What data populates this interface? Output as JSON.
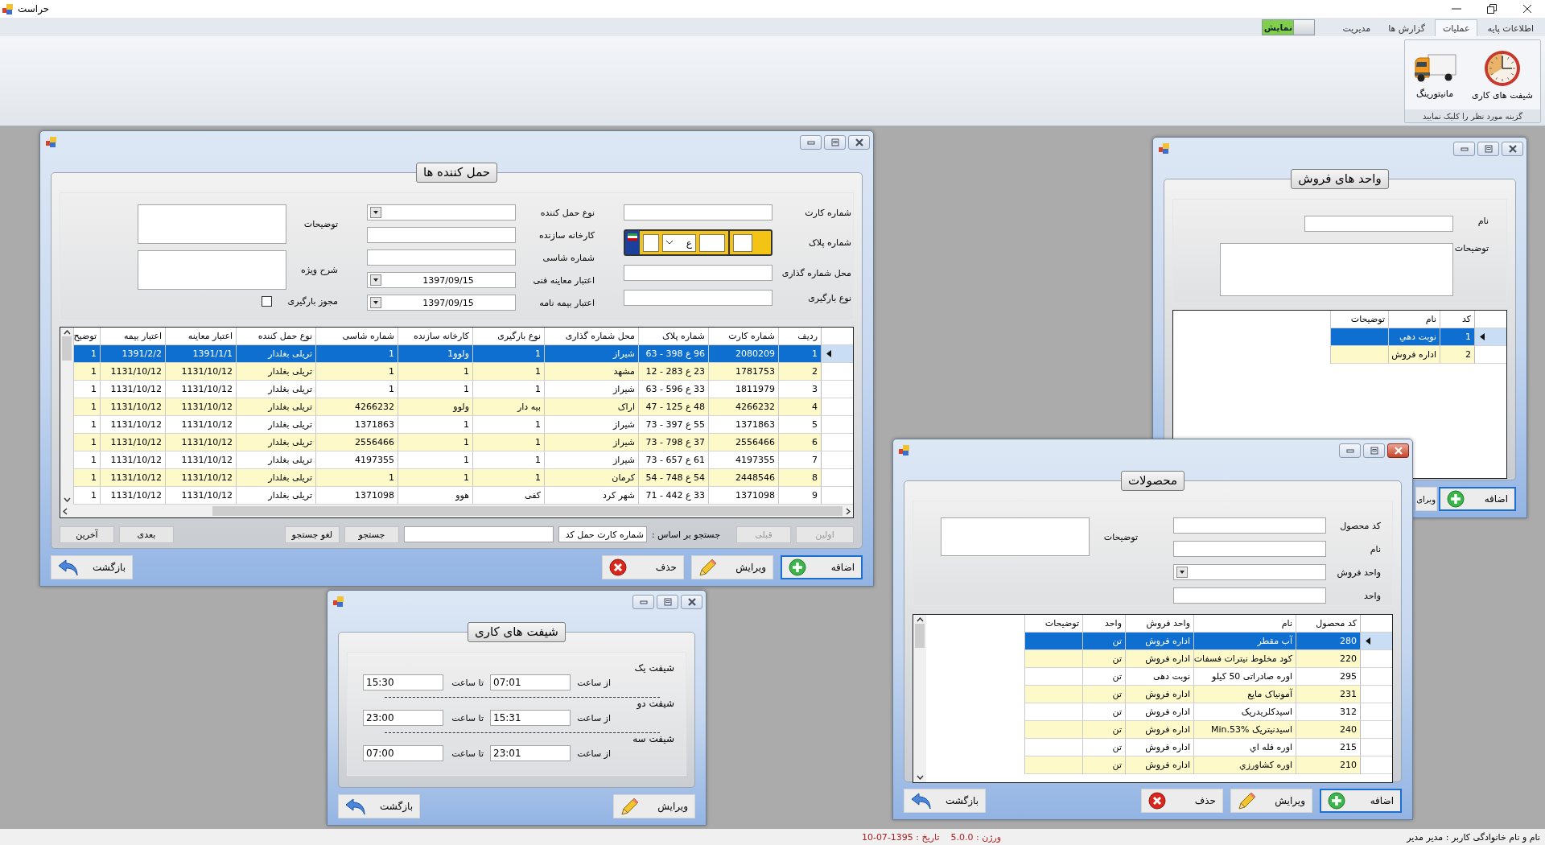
{
  "app": {
    "title": "حراست"
  },
  "ribbon": {
    "tabs": [
      {
        "label": "اطلاعات پایه",
        "selected": false
      },
      {
        "label": "عملیات",
        "selected": true
      },
      {
        "label": "گزارش ها",
        "selected": false
      },
      {
        "label": "مدیریت",
        "selected": false
      }
    ],
    "toggle": {
      "label": "نمایش",
      "on": true
    },
    "group": {
      "caption": "گزینه مورد نظر را کلیک نمایید",
      "buttons": [
        {
          "label": "شیفت های کاری",
          "kind": "clock"
        },
        {
          "label": "مانیتورینگ",
          "kind": "truck"
        }
      ]
    }
  },
  "carriers_window": {
    "active": false,
    "heading": "حمل کننده ها",
    "form_columns": [
      [
        {
          "kind": "text",
          "label": "شماره کارت"
        },
        {
          "kind": "plate",
          "label": "شماره پلاک",
          "letter": "ع"
        },
        {
          "kind": "text",
          "label": "محل شماره گذاری"
        },
        {
          "kind": "text",
          "label": "نوع بارگیری"
        }
      ],
      [
        {
          "kind": "combo",
          "label": "نوع حمل کننده"
        },
        {
          "kind": "text",
          "label": "کارخانه سازنده"
        },
        {
          "kind": "text",
          "label": "شماره شاسی"
        },
        {
          "kind": "date",
          "label": "اعتبار معاینه فنی",
          "value": "1397/09/15"
        },
        {
          "kind": "date",
          "label": "اعتبار بیمه نامه",
          "value": "1397/09/15"
        }
      ],
      [
        {
          "kind": "memo",
          "label": "توضیحات"
        },
        {
          "kind": "memo",
          "label": "شرح ویژه"
        },
        {
          "kind": "checkbox",
          "label": "مجوز بارگیری",
          "checked": false
        }
      ]
    ],
    "table": {
      "columns": [
        "ردیف",
        "شماره کارت",
        "شماره پلاک",
        "محل شماره گذاری",
        "نوع بارگیری",
        "کارخانه سازنده",
        "شماره شاسی",
        "نوع حمل کننده",
        "اعتبار معاینه",
        "اعتبار بیمه",
        "توضیح"
      ],
      "rows": [
        {
          "selected": true,
          "cells": [
            "1",
            "2080209",
            "63 - 398 ع 96",
            "شیراز",
            "1",
            "ولوو1",
            "1",
            "تریلی بغلدار",
            "1391/1/1",
            "1391/2/2",
            "1"
          ]
        },
        {
          "selected": false,
          "cells": [
            "2",
            "1781753",
            "12 - 283 ع 23",
            "مشهد",
            "1",
            "1",
            "1",
            "تریلی بغلدار",
            "1131/10/12",
            "1131/10/12",
            "1"
          ]
        },
        {
          "selected": false,
          "cells": [
            "3",
            "1811979",
            "63 - 596 ع 33",
            "شیراز",
            "1",
            "1",
            "1",
            "تریلی بغلدار",
            "1131/10/12",
            "1131/10/12",
            "1"
          ]
        },
        {
          "selected": false,
          "cells": [
            "4",
            "4266232",
            "47 - 125 ع 48",
            "اراک",
            "بیه دار",
            "ولوو",
            "4266232",
            "تریلی بغلدار",
            "1131/10/12",
            "1131/10/12",
            "1"
          ]
        },
        {
          "selected": false,
          "cells": [
            "5",
            "1371863",
            "73 - 397 ع 55",
            "شیراز",
            "1",
            "1",
            "1371863",
            "تریلی بغلدار",
            "1131/10/12",
            "1131/10/12",
            "1"
          ]
        },
        {
          "selected": false,
          "cells": [
            "6",
            "2556466",
            "73 - 798 ع 37",
            "شیراز",
            "1",
            "1",
            "2556466",
            "تریلی بغلدار",
            "1131/10/12",
            "1131/10/12",
            "1"
          ]
        },
        {
          "selected": false,
          "cells": [
            "7",
            "4197355",
            "73 - 657 ع 61",
            "شیراز",
            "1",
            "1",
            "4197355",
            "تریلی بغلدار",
            "1131/10/12",
            "1131/10/12",
            "1"
          ]
        },
        {
          "selected": false,
          "cells": [
            "8",
            "2448546",
            "54 - 748 ع 54",
            "کرمان",
            "1",
            "1",
            "1",
            "تریلی بغلدار",
            "1131/10/12",
            "1131/10/12",
            "1"
          ]
        },
        {
          "selected": false,
          "cells": [
            "9",
            "1371098",
            "71 - 442 ع 33",
            "شهر کرد",
            "کفی",
            "هوو",
            "1371098",
            "تریلی بغلدار",
            "1131/10/12",
            "1131/10/12",
            "1"
          ]
        }
      ]
    },
    "pager": [
      {
        "label": "اولین",
        "disabled": true
      },
      {
        "label": "قبلی",
        "disabled": true
      },
      {
        "label": "بعدی",
        "disabled": false
      },
      {
        "label": "آخرین",
        "disabled": false
      }
    ],
    "search": {
      "label": "جستجو بر اساس :",
      "field": "شماره کارت حمل کد",
      "buttons": [
        "جستجو",
        "لغو جستجو"
      ]
    },
    "buttons": [
      {
        "label": "اضافه",
        "kind": "add",
        "default": true
      },
      {
        "label": "ویرایش",
        "kind": "edit",
        "default": false
      },
      {
        "label": "حذف",
        "kind": "delete",
        "default": false
      },
      {
        "label": "بازگشت",
        "kind": "back",
        "default": false
      }
    ]
  },
  "sales_units_window": {
    "active": false,
    "heading": "واحد های فروش",
    "form_columns": [
      [
        {
          "kind": "text",
          "label": "نام"
        },
        {
          "kind": "memo",
          "label": "توضیحات"
        }
      ]
    ],
    "table": {
      "columns": [
        "کد",
        "نام",
        "توضیحات"
      ],
      "rows": [
        {
          "selected": true,
          "cells": [
            "1",
            "نوبت دهي"
          ]
        },
        {
          "selected": false,
          "cells": [
            "2",
            "اداره فروش"
          ]
        }
      ]
    },
    "buttons": [
      {
        "label": "اضافه",
        "kind": "add",
        "default": true
      },
      {
        "label": "ویرای",
        "kind": "cut",
        "default": false
      }
    ]
  },
  "products_window": {
    "active": true,
    "heading": "محصولات",
    "form_columns": [
      [
        {
          "kind": "text",
          "label": "کد محصول"
        },
        {
          "kind": "text",
          "label": "نام"
        },
        {
          "kind": "combo",
          "label": "واحد فروش"
        },
        {
          "kind": "text",
          "label": "واحد"
        }
      ],
      [
        {
          "kind": "memo",
          "label": "توضیحات"
        }
      ]
    ],
    "table": {
      "columns": [
        "کد محصول",
        "نام",
        "واحد فروش",
        "واحد",
        "توضیحات"
      ],
      "rows": [
        {
          "selected": true,
          "cells": [
            "280",
            "آب مقطر",
            "اداره فروش",
            "تن"
          ]
        },
        {
          "selected": false,
          "cells": [
            "220",
            "کود مخلوط نیترات فسفات",
            "اداره فروش",
            "تن"
          ]
        },
        {
          "selected": false,
          "cells": [
            "295",
            "اوره صادراتی 50 کیلو",
            "نوبت دهی",
            "تن"
          ]
        },
        {
          "selected": false,
          "cells": [
            "231",
            "آمونیاک مایع",
            "اداره فروش",
            "تن"
          ]
        },
        {
          "selected": false,
          "cells": [
            "312",
            "اسیدکلریدریک",
            "اداره فروش",
            "تن"
          ]
        },
        {
          "selected": false,
          "cells": [
            "240",
            "اسیدنیتریک Min.53%",
            "اداره فروش",
            "تن"
          ]
        },
        {
          "selected": false,
          "cells": [
            "215",
            "اوره فله اي",
            "اداره فروش",
            "تن"
          ]
        },
        {
          "selected": false,
          "cells": [
            "210",
            "اوره کشاورزي",
            "اداره فروش",
            "تن"
          ]
        }
      ]
    },
    "buttons": [
      {
        "label": "اضافه",
        "kind": "add",
        "default": true
      },
      {
        "label": "ویرایش",
        "kind": "edit",
        "default": false
      },
      {
        "label": "حذف",
        "kind": "delete",
        "default": false
      },
      {
        "label": "بازگشت",
        "kind": "back",
        "default": false
      }
    ]
  },
  "shifts_window": {
    "active": false,
    "heading": "شیفت های کاری",
    "shifts": [
      {
        "label": "شیفت یک",
        "from_label": "از ساعت",
        "from": "07:01",
        "to_label": "تا ساعت",
        "to": "15:30"
      },
      {
        "label": "شیفت دو",
        "from_label": "از ساعت",
        "from": "15:31",
        "to_label": "تا ساعت",
        "to": "23:00"
      },
      {
        "label": "شیفت سه",
        "from_label": "از ساعت",
        "from": "23:01",
        "to_label": "تا ساعت",
        "to": "07:00"
      }
    ],
    "buttons": [
      {
        "label": "ویرایش",
        "kind": "edit",
        "default": false
      },
      {
        "label": "بازگشت",
        "kind": "back",
        "default": false
      }
    ]
  },
  "status_bar": {
    "user": "نام و نام خانوادگی کاربر : مدیر مدیر",
    "version": "ورژن : 5.0.0",
    "date": "تاریخ : 1395-07-10"
  }
}
